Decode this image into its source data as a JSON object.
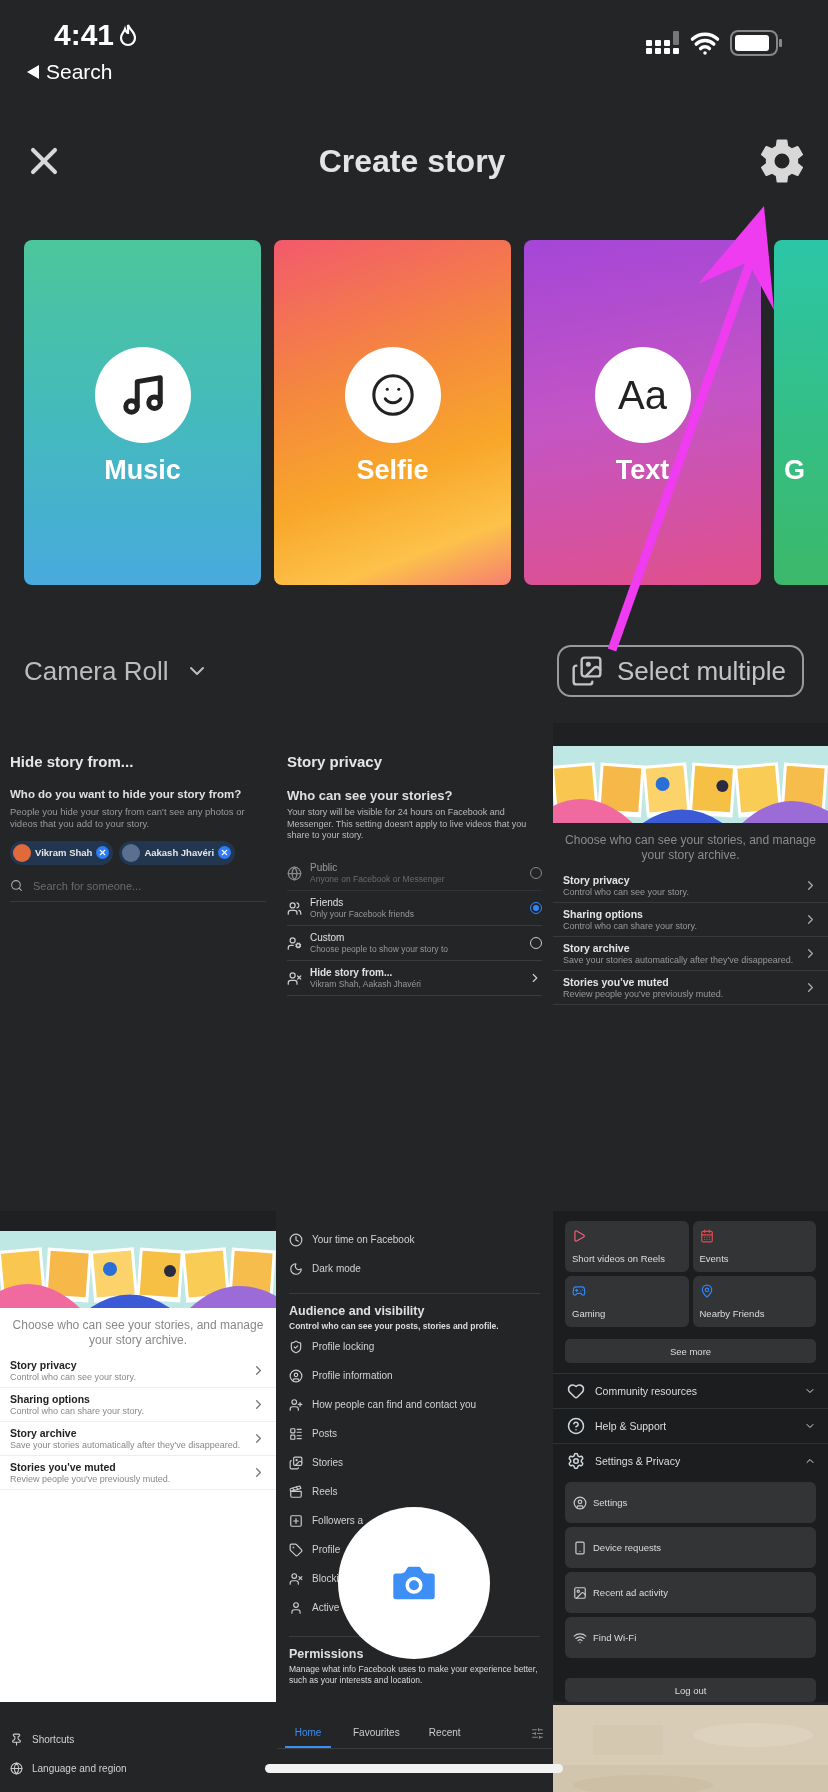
{
  "status_bar": {
    "time": "4:41",
    "back_label": "Search"
  },
  "header": {
    "title": "Create story"
  },
  "story_cards": [
    {
      "kind": "music",
      "label": "Music"
    },
    {
      "kind": "selfie",
      "label": "Selfie"
    },
    {
      "kind": "text",
      "label": "Text",
      "icon_text": "Aa"
    },
    {
      "kind": "partial",
      "label": "G"
    }
  ],
  "album_picker": {
    "label": "Camera Roll"
  },
  "select_button": {
    "label": "Select multiple"
  },
  "thumbnails": [
    {
      "kind": "hide_story",
      "title": "Hide story from...",
      "heading": "Who do you want to hide your story from?",
      "body": "People you hide your story from can't see any photos or videos that you add to your story.",
      "chips": [
        "Vikram Shah",
        "Aakash Jhavéri"
      ],
      "search_placeholder": "Search for someone..."
    },
    {
      "kind": "story_privacy",
      "title": "Story privacy",
      "heading": "Who can see your stories?",
      "body": "Your story will be visible for 24 hours on Facebook and Messenger. This setting doesn't apply to live videos that you share to your story.",
      "options": [
        {
          "title": "Public",
          "subtitle": "Anyone on Facebook or Messenger",
          "selected": false,
          "disabled": true
        },
        {
          "title": "Friends",
          "subtitle": "Only your Facebook friends",
          "selected": true,
          "disabled": false
        },
        {
          "title": "Custom",
          "subtitle": "Choose people to show your story to",
          "selected": false,
          "disabled": false
        }
      ],
      "link_row": {
        "title": "Hide story from...",
        "subtitle": "Vikram Shah, Aakash Jhavéri"
      }
    },
    {
      "kind": "story_settings",
      "light_theme": false,
      "intro": "Choose who can see your stories, and manage your story archive.",
      "rows": [
        {
          "title": "Story privacy",
          "subtitle": "Control who can see your story."
        },
        {
          "title": "Sharing options",
          "subtitle": "Control who can share your story."
        },
        {
          "title": "Story archive",
          "subtitle": "Save your stories automatically after they've disappeared."
        },
        {
          "title": "Stories you've muted",
          "subtitle": "Review people you've previously muted."
        }
      ]
    },
    {
      "kind": "story_settings",
      "light_theme": true,
      "intro": "Choose who can see your stories, and manage your story archive.",
      "rows": [
        {
          "title": "Story privacy",
          "subtitle": "Control who can see your story."
        },
        {
          "title": "Sharing options",
          "subtitle": "Control who can share your story."
        },
        {
          "title": "Story archive",
          "subtitle": "Save your stories automatically after they've disappeared."
        },
        {
          "title": "Stories you've muted",
          "subtitle": "Review people you've previously muted."
        }
      ]
    },
    {
      "kind": "settings_list",
      "top_items": [
        "Your time on Facebook",
        "Dark mode"
      ],
      "section_title": "Audience and visibility",
      "section_desc": "Control who can see your posts, stories and profile.",
      "items": [
        "Profile locking",
        "Profile information",
        "How people can find and contact you",
        "Posts",
        "Stories",
        "Reels",
        "Followers a",
        "Profile",
        "Blocki",
        "Active"
      ],
      "footer_title": "Permissions",
      "footer_desc": "Manage what info Facebook uses to make your experience better, such as your interests and location."
    },
    {
      "kind": "menu",
      "tiles": [
        "Short videos on Reels",
        "Events",
        "Gaming",
        "Nearby Friends"
      ],
      "see_more": "See more",
      "sections": [
        {
          "label": "Community resources",
          "expanded": false
        },
        {
          "label": "Help & Support",
          "expanded": false
        },
        {
          "label": "Settings & Privacy",
          "expanded": true
        }
      ],
      "sub_items": [
        "Settings",
        "Device requests",
        "Recent ad activity",
        "Find Wi-Fi"
      ],
      "logout": "Log out"
    },
    {
      "kind": "shortcuts_list",
      "items": [
        "Shortcuts",
        "Language and region"
      ]
    },
    {
      "kind": "feed_tabs",
      "tabs": [
        {
          "label": "Home",
          "selected": true
        },
        {
          "label": "Favourites",
          "selected": false
        },
        {
          "label": "Recent",
          "selected": false
        }
      ]
    },
    {
      "kind": "picture"
    }
  ]
}
